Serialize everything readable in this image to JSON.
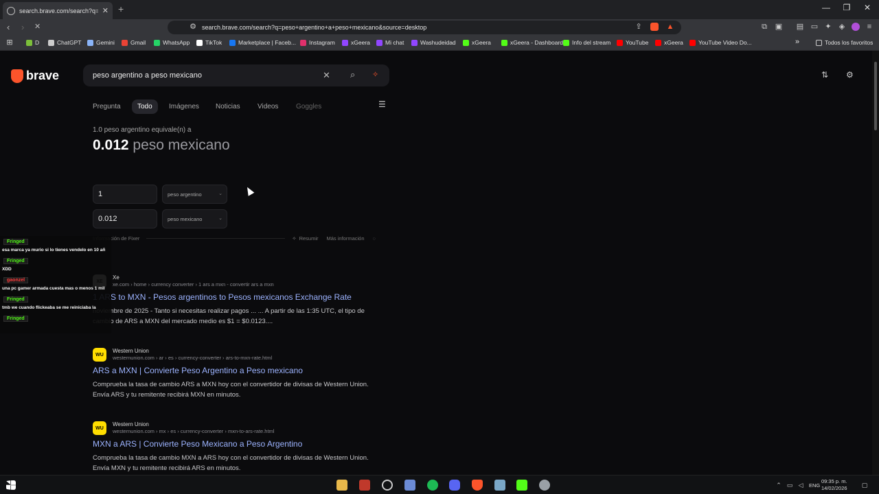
{
  "browser": {
    "tab_title": "search.brave.com/search?q=pes",
    "url": "search.brave.com/search?q=peso+argentino+a+peso+mexicano&source=desktop",
    "bookmarks": [
      {
        "label": "D",
        "color": "#7cbf3a"
      },
      {
        "label": "ChatGPT",
        "color": "#cccccc"
      },
      {
        "label": "Gemini",
        "color": "#8ab4f8"
      },
      {
        "label": "Gmail",
        "color": "#ea4335"
      },
      {
        "label": "WhatsApp",
        "color": "#25d366"
      },
      {
        "label": "TikTok",
        "color": "#ffffff"
      },
      {
        "label": "Marketplace | Faceb...",
        "color": "#1877f2"
      },
      {
        "label": "Instagram",
        "color": "#e1306c"
      },
      {
        "label": "xGeera",
        "color": "#9146ff"
      },
      {
        "label": "Mi chat",
        "color": "#9146ff"
      },
      {
        "label": "Washudeidad",
        "color": "#9146ff"
      },
      {
        "label": "xGeera",
        "color": "#53fc18"
      },
      {
        "label": "xGeera - Dashboard",
        "color": "#53fc18"
      },
      {
        "label": "Info del stream",
        "color": "#53fc18"
      },
      {
        "label": "YouTube",
        "color": "#ff0000"
      },
      {
        "label": "xGeera",
        "color": "#ff0000"
      },
      {
        "label": "YouTube Video Do...",
        "color": "#ff0000"
      }
    ],
    "bookmarks_overflow": "»",
    "all_bookmarks": "Todos los favoritos"
  },
  "search": {
    "logo_text": "brave",
    "query": "peso argentino a peso mexicano",
    "tabs": [
      "Pregunta",
      "Todo",
      "Imágenes",
      "Noticias",
      "Videos",
      "Goggles"
    ],
    "active_tab": "Todo"
  },
  "converter": {
    "equivalence": "1.0 peso argentino equivale(n) a",
    "result_value": "0.012",
    "result_unit": "peso mexicano",
    "from_amount": "1",
    "from_currency": "peso argentino",
    "to_amount": "0.012",
    "to_currency": "peso mexicano",
    "source": "Información de Fixer",
    "summarize": "Resumir",
    "more_info": "Más información"
  },
  "results": [
    {
      "site": "Xe",
      "favicon": "XE",
      "url": "xe.com › home › currency converter › 1 ars a mxn - convertir ars a mxn",
      "title": "1 ARS to MXN - Pesos argentinos to Pesos mexicanos Exchange Rate",
      "desc": "noviembre de 2025 - Tanto si necesitas realizar pagos ... ... A partir de las 1:35 UTC, el tipo de cambio de ARS a MXN del mercado medio es $1 = $0.0123...."
    },
    {
      "site": "Western Union",
      "favicon": "WU",
      "url": "westernunion.com › ar › es › currency-converter › ars-to-mxn-rate.html",
      "title": "ARS a MXN | Convierte Peso Argentino a Peso mexicano",
      "desc": "Comprueba la tasa de cambio ARS a MXN hoy con el convertidor de divisas de Western Union. Envía ARS y tu remitente recibirá MXN en minutos."
    },
    {
      "site": "Western Union",
      "favicon": "WU",
      "url": "westernunion.com › mx › es › currency-converter › mxn-to-ars-rate.html",
      "title": "MXN a ARS | Convierte Peso Mexicano a Peso Argentino",
      "desc": "Comprueba la tasa de cambio MXN a ARS hoy con el convertidor de divisas de Western Union. Envía MXN y tu remitente recibirá ARS en minutos."
    }
  ],
  "chat": [
    {
      "name": "Fringed",
      "message": "esa marca ya murio si lo tienes vendelo en 10 añ",
      "color": "#53fc18"
    },
    {
      "name": "Fringed",
      "message": "XDD",
      "color": "#53fc18"
    },
    {
      "name": "gaonzel",
      "message": "una pc gamer armada cuesta mas o menos 1 mil",
      "color": "#ff3b3b"
    },
    {
      "name": "Fringed",
      "message": "tmb we cuando flickeaba se me reiniciaba la",
      "color": "#53fc18"
    },
    {
      "name": "Fringed",
      "message": "",
      "color": "#53fc18"
    }
  ],
  "taskbar": {
    "language": "ENG",
    "time": "09:35 p. m.",
    "date": "14/02/2026"
  }
}
